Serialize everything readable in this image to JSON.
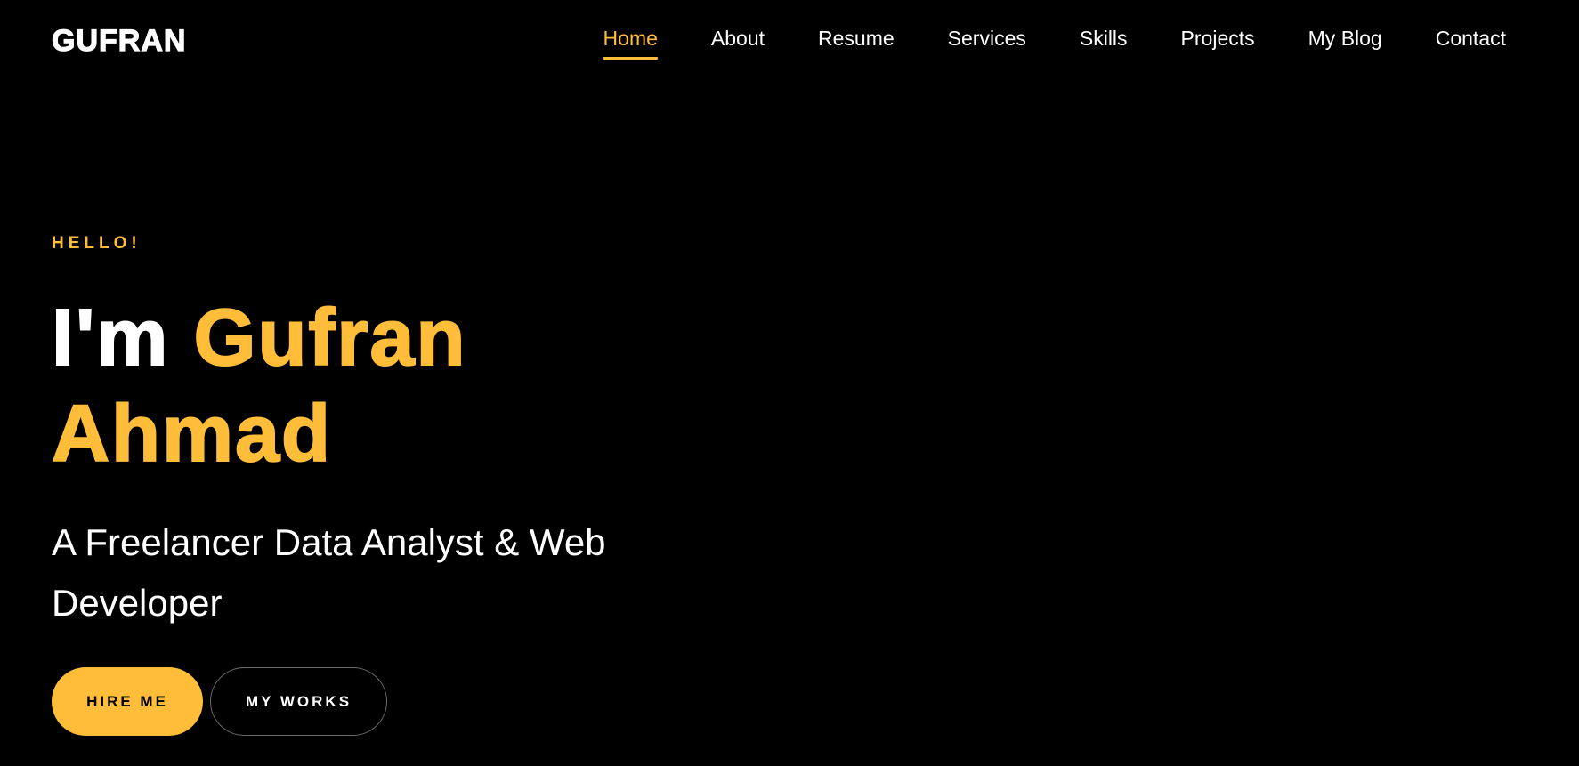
{
  "brand": {
    "name": "GUFRAN"
  },
  "nav": {
    "items": [
      {
        "label": "Home",
        "active": true
      },
      {
        "label": "About",
        "active": false
      },
      {
        "label": "Resume",
        "active": false
      },
      {
        "label": "Services",
        "active": false
      },
      {
        "label": "Skills",
        "active": false
      },
      {
        "label": "Projects",
        "active": false
      },
      {
        "label": "My Blog",
        "active": false
      },
      {
        "label": "Contact",
        "active": false
      }
    ]
  },
  "hero": {
    "greeting": "HELLO!",
    "intro": "I'm",
    "first_name": "Gufran",
    "last_name": "Ahmad",
    "subtitle": "A Freelancer Data Analyst & Web Developer",
    "primary_button": "HIRE ME",
    "secondary_button": "MY WORKS"
  },
  "colors": {
    "background": "#000000",
    "accent": "#ffbd39",
    "text": "#ffffff"
  }
}
